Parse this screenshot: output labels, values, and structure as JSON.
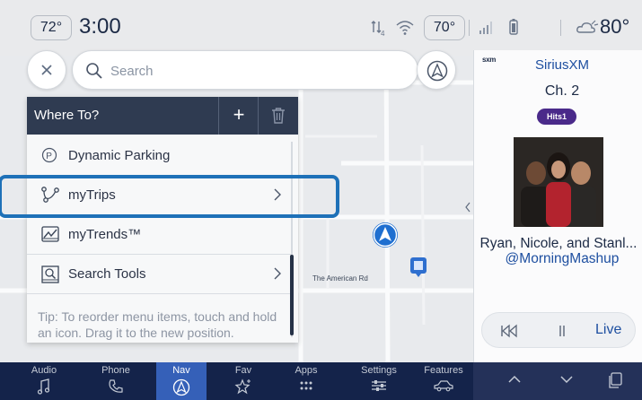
{
  "status_bar": {
    "outside_temp": "72°",
    "time": "3:00",
    "cabin_temp": "70°",
    "weather_temp": "80°",
    "icons": [
      "phone-signal-icon",
      "wifi-icon",
      "cell-signal-icon",
      "phone-battery-icon",
      "weather-cloudy-icon"
    ]
  },
  "search": {
    "placeholder": "Search",
    "close_icon": "close-icon",
    "record_icon": "auto-navigation-icon"
  },
  "where_to": {
    "title": "Where To?",
    "add_label": "+",
    "items": [
      {
        "label": "Dynamic Parking",
        "icon": "parking-icon",
        "has_chevron": false
      },
      {
        "label": "myTrips",
        "icon": "trip-route-icon",
        "has_chevron": true
      },
      {
        "label": "myTrends™",
        "icon": "trends-icon",
        "has_chevron": false
      },
      {
        "label": "Search Tools",
        "icon": "search-tools-icon",
        "has_chevron": true
      }
    ],
    "tip": "Tip: To reorder menu items, touch and hold an icon. Drag it to the new position."
  },
  "map": {
    "street_label": "The American Rd"
  },
  "media": {
    "source_logo": "sxm",
    "source": "SiriusXM",
    "channel": "Ch. 2",
    "channel_logo": "Hits1",
    "artist": "Ryan, Nicole, and Stanl...",
    "handle": "@MorningMashup",
    "live_label": "Live"
  },
  "bottom_nav": {
    "items": [
      {
        "label": "Audio",
        "icon": "music-note-icon"
      },
      {
        "label": "Phone",
        "icon": "phone-icon"
      },
      {
        "label": "Nav",
        "icon": "nav-icon"
      },
      {
        "label": "Fav",
        "icon": "star-icon"
      },
      {
        "label": "Apps",
        "icon": "apps-grid-icon"
      },
      {
        "label": "Settings",
        "icon": "settings-sliders-icon"
      },
      {
        "label": "Features",
        "icon": "car-icon"
      }
    ],
    "active": "Nav"
  },
  "colors": {
    "accent": "#1e71b8",
    "nav_bg": "#14234a",
    "active_tab": "#3560b8",
    "panel_header": "#2f3b51",
    "link": "#1e4fa0"
  }
}
